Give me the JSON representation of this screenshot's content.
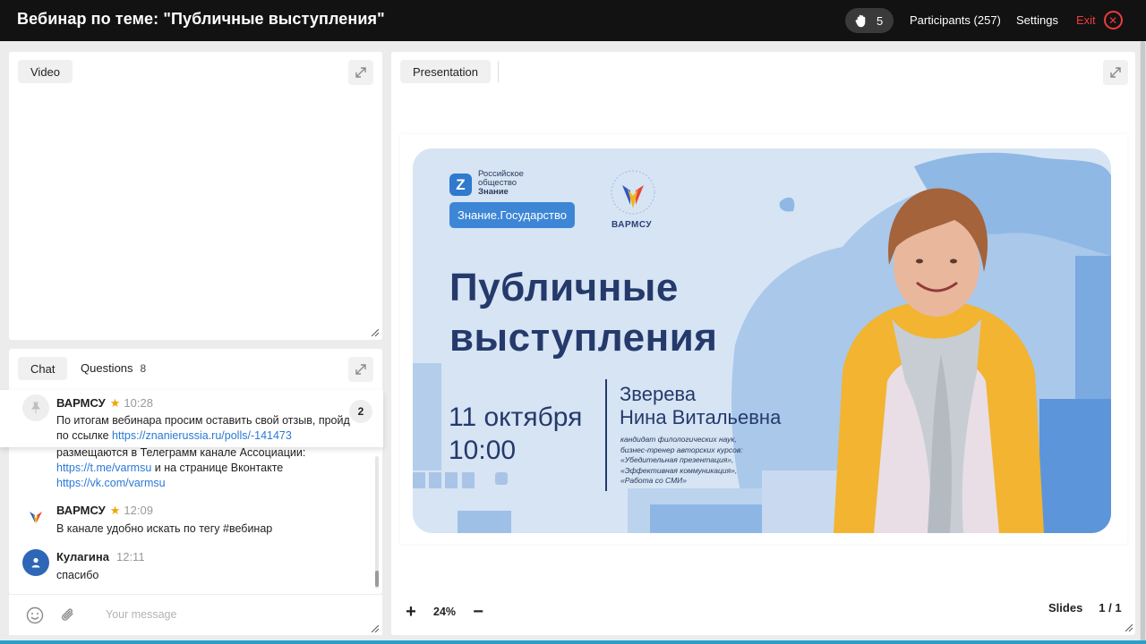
{
  "header": {
    "title": "Вебинар по теме: \"Публичные выступления\"",
    "raised_hands": "5",
    "participants_label": "Participants (257)",
    "settings_label": "Settings",
    "exit_label": "Exit"
  },
  "video_panel": {
    "tab_label": "Video"
  },
  "presentation_panel": {
    "tab_label": "Presentation"
  },
  "chat_panel": {
    "tab_chat": "Chat",
    "tab_questions": "Questions",
    "questions_count": "8",
    "pinned": {
      "author": "ВАРМСУ",
      "time": "10:28",
      "line1": "По итогам вебинара просим оставить свой отзыв, пройд",
      "line2_prefix": "по ссылке ",
      "line2_link": "https://znanierussia.ru/polls/-141473",
      "badge": "2"
    },
    "partial_message": {
      "line1": "размещаются в Телеграмм канале Ассоциации:",
      "line2_link": "https://t.me/varmsu",
      "line2_suffix": " и на странице Вконтакте",
      "line3_link": "https://vk.com/varmsu"
    },
    "messages": [
      {
        "author": "ВАРМСУ",
        "time": "12:09",
        "text": "В канале удобно искать по тегу #вебинар"
      },
      {
        "author": "Кулагина",
        "time": "12:11",
        "text": "спасибо"
      }
    ],
    "composer_placeholder": "Your message"
  },
  "slide": {
    "org_line1": "Российское",
    "org_line2": "общество",
    "org_line3": "Знание",
    "program_badge": "Знание.Государство",
    "partner_logo_text": "ВАРМСУ",
    "title_line1": "Публичные",
    "title_line2": "выступления",
    "date": "11 октября",
    "time": "10:00",
    "speaker_line1": "Зверева",
    "speaker_line2": "Нина Витальевна",
    "bio_line1": "кандидат филологических наук,",
    "bio_line2": "бизнес-тренер авторских курсов:",
    "bio_line3": "«Убедительная презентация»,",
    "bio_line4": "«Эффективная коммуникация»,",
    "bio_line5": "«Работа со СМИ»"
  },
  "presentation_controls": {
    "zoom_level": "24%",
    "slides_label": "Slides",
    "slide_counter": "1 / 1"
  },
  "colors": {
    "header_bg": "#121212",
    "exit_red": "#ef3b3b",
    "link_blue": "#2a78d6",
    "slide_navy": "#253a6b",
    "slide_bg": "#d6e4f4",
    "star": "#f0a500"
  }
}
